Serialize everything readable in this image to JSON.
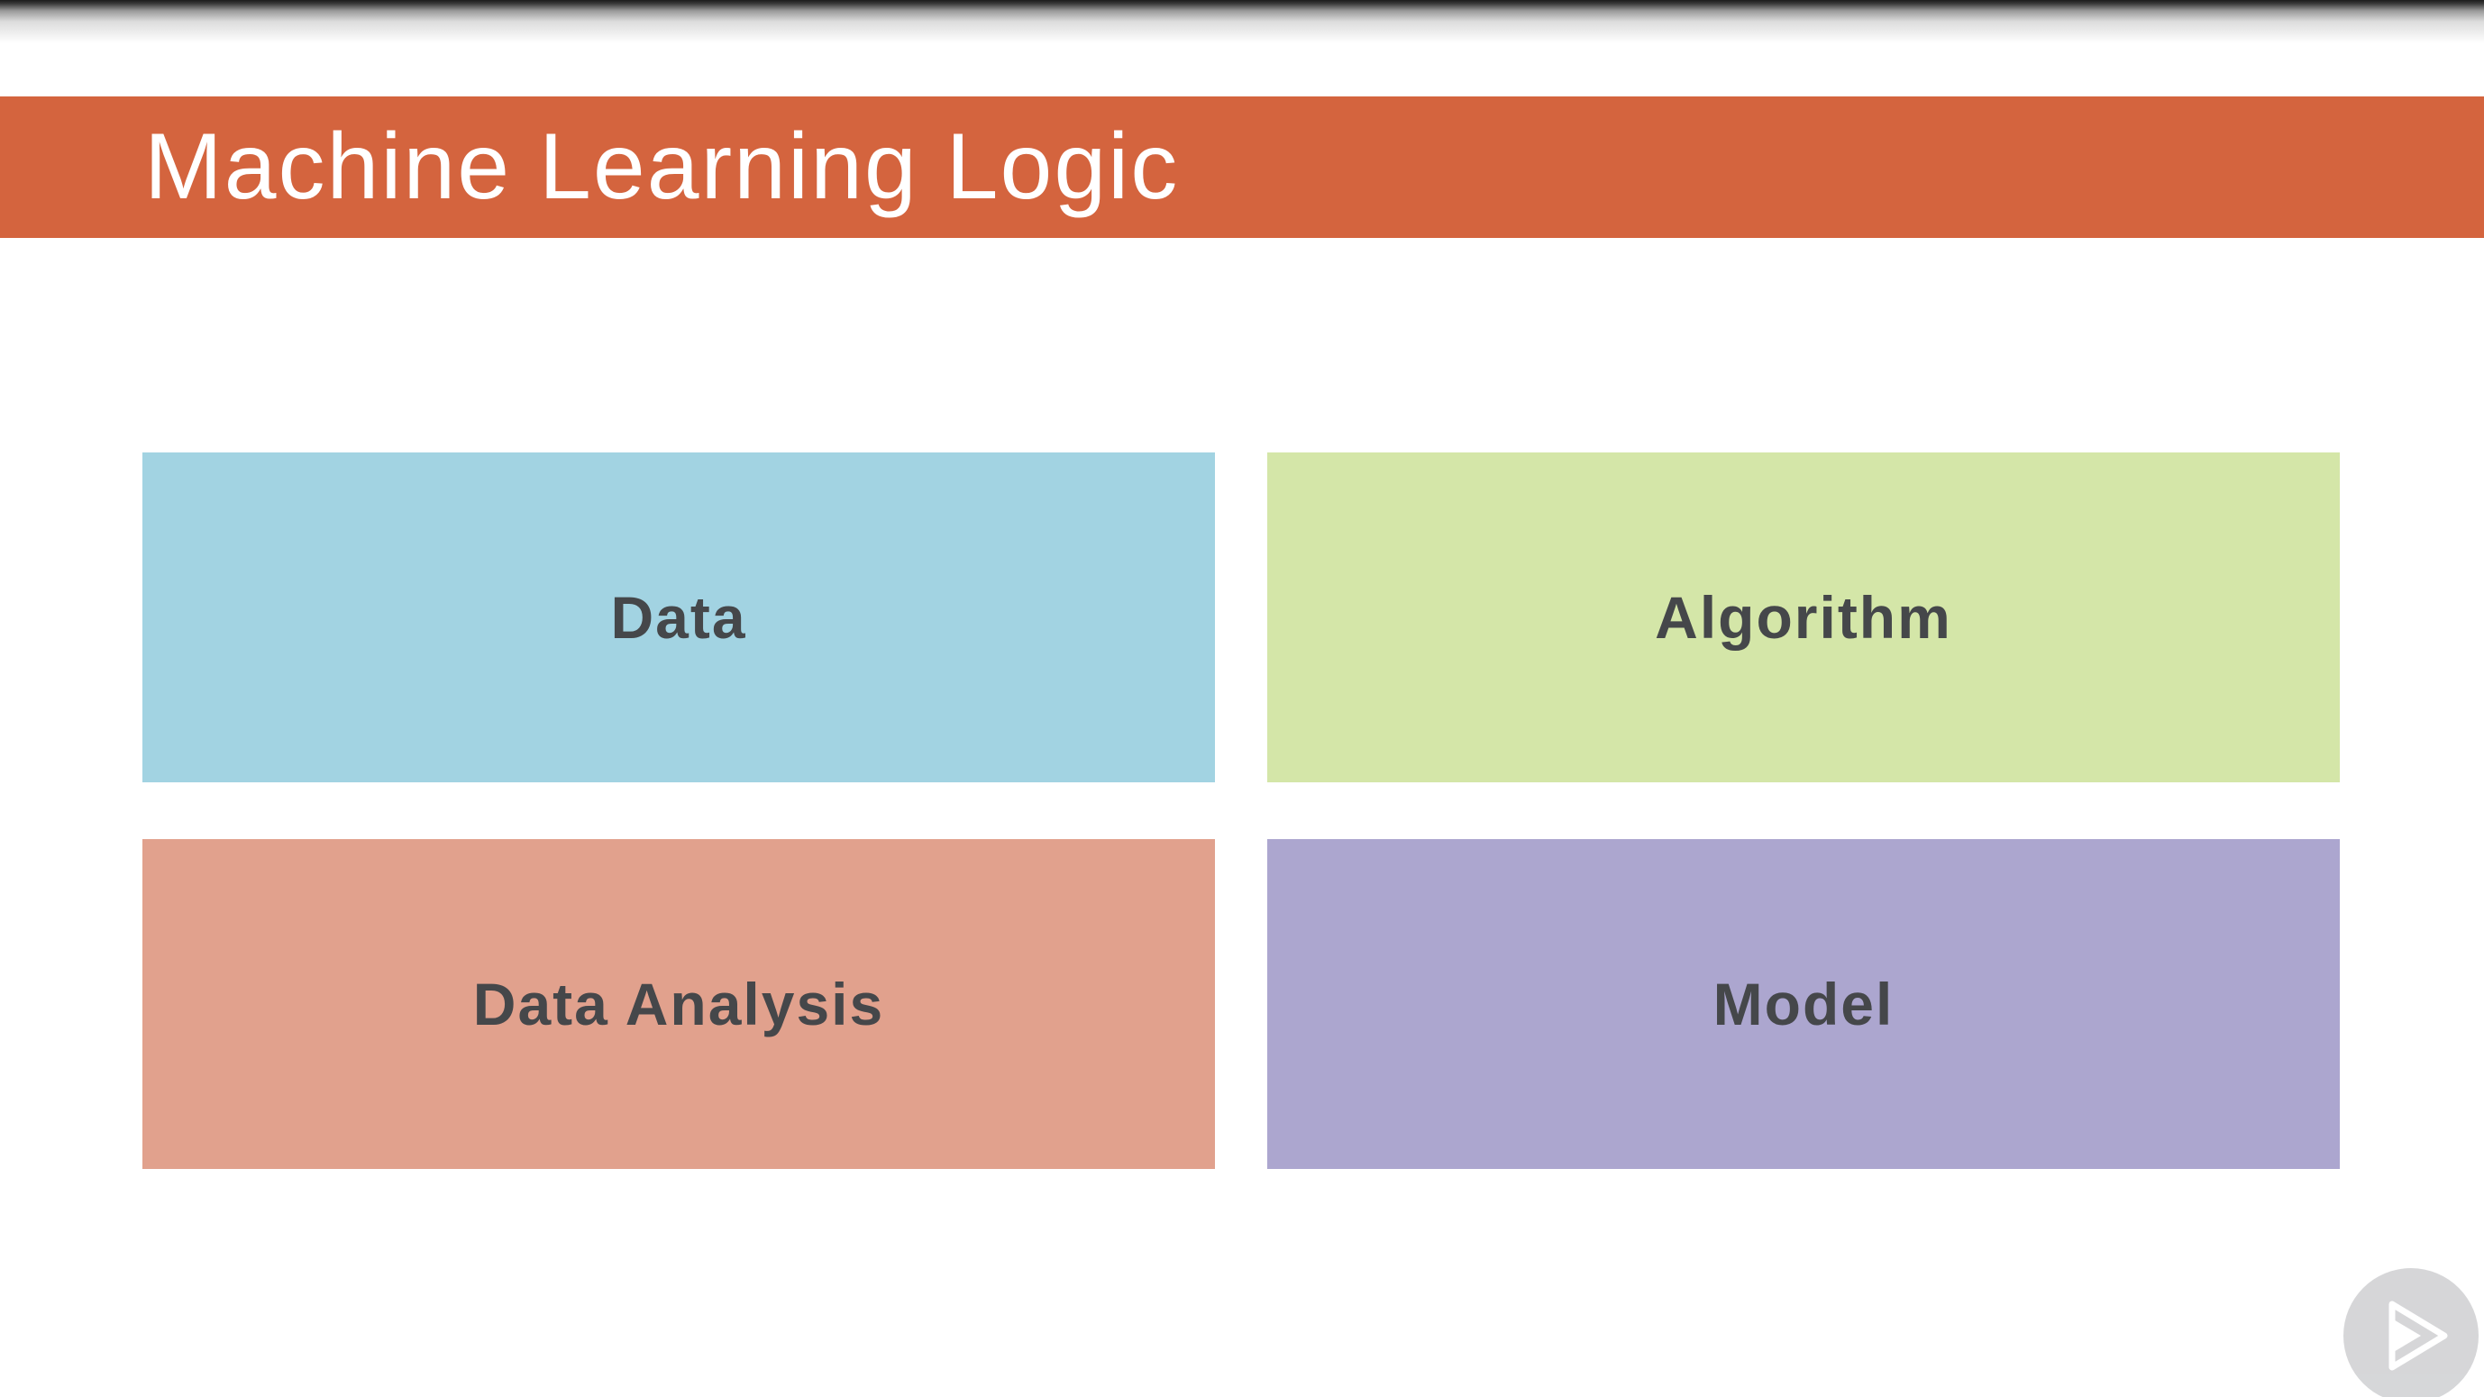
{
  "slide": {
    "title": "Machine Learning Logic",
    "title_bar_color": "#d4643e",
    "tiles": [
      {
        "label": "Data",
        "color": "#a2d3e2"
      },
      {
        "label": "Algorithm",
        "color": "#d4e6a8"
      },
      {
        "label": "Data Analysis",
        "color": "#e1a18d"
      },
      {
        "label": "Model",
        "color": "#aca6cf"
      }
    ]
  },
  "player": {
    "play_icon": "play-icon"
  }
}
